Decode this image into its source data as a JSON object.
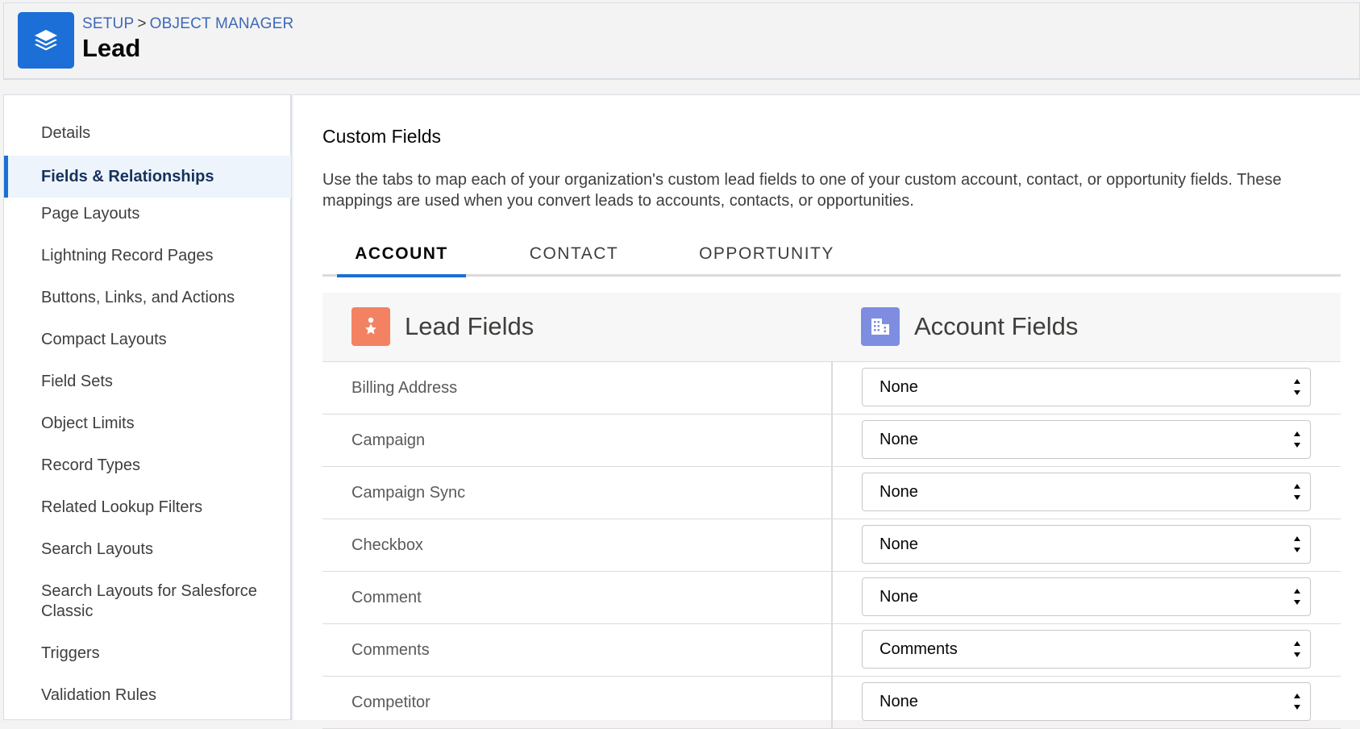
{
  "header": {
    "breadcrumb": [
      "SETUP",
      "OBJECT MANAGER"
    ],
    "breadcrumb_sep": ">",
    "title": "Lead",
    "icon": "stacked-layers-icon"
  },
  "sidebar": {
    "items": [
      {
        "label": "Details"
      },
      {
        "label": "Fields & Relationships",
        "active": true
      },
      {
        "label": "Page Layouts"
      },
      {
        "label": "Lightning Record Pages"
      },
      {
        "label": "Buttons, Links, and Actions"
      },
      {
        "label": "Compact Layouts"
      },
      {
        "label": "Field Sets"
      },
      {
        "label": "Object Limits"
      },
      {
        "label": "Record Types"
      },
      {
        "label": "Related Lookup Filters"
      },
      {
        "label": "Search Layouts"
      },
      {
        "label": "Search Layouts for Salesforce Classic"
      },
      {
        "label": "Triggers"
      },
      {
        "label": "Validation Rules"
      }
    ]
  },
  "main": {
    "section_title": "Custom Fields",
    "description": "Use the tabs to map each of your organization's custom lead fields to one of your custom account, contact, or opportunity fields. These mappings are used when you convert leads to accounts, contacts, or opportunities.",
    "tabs": [
      {
        "label": "ACCOUNT",
        "active": true
      },
      {
        "label": "CONTACT"
      },
      {
        "label": "OPPORTUNITY"
      }
    ],
    "columns": {
      "left": {
        "label": "Lead Fields",
        "icon": "lead-star-icon",
        "color": "#f38262"
      },
      "right": {
        "label": "Account Fields",
        "icon": "account-building-icon",
        "color": "#7f8de1"
      }
    },
    "rows": [
      {
        "field": "Billing Address",
        "mapping": "None"
      },
      {
        "field": "Campaign",
        "mapping": "None"
      },
      {
        "field": "Campaign Sync",
        "mapping": "None"
      },
      {
        "field": "Checkbox",
        "mapping": "None"
      },
      {
        "field": "Comment",
        "mapping": "None"
      },
      {
        "field": "Comments",
        "mapping": "Comments"
      },
      {
        "field": "Competitor",
        "mapping": "None"
      }
    ]
  },
  "colors": {
    "brand": "#1b6fd6",
    "link": "#3e68b8",
    "active_bg": "#eef4fc"
  }
}
